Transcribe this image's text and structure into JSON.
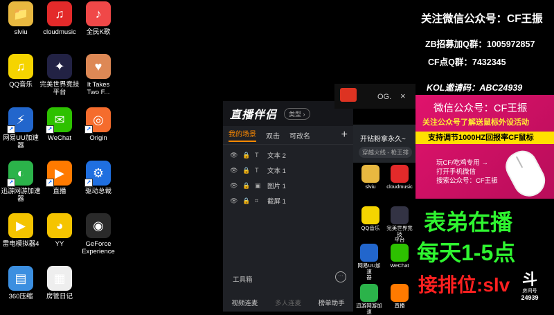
{
  "desktop_icons": [
    {
      "label": "slviu",
      "color": "#e8b840",
      "glyph": "📁"
    },
    {
      "label": "cloudmusic",
      "color": "#e32a2a",
      "glyph": "♫"
    },
    {
      "label": "全民K歌",
      "color": "#f04848",
      "glyph": "♪"
    },
    {
      "label": "QQ音乐",
      "color": "#f5d400",
      "glyph": "♫"
    },
    {
      "label": "完美世界竞技\n平台",
      "color": "#224",
      "glyph": "✦"
    },
    {
      "label": "It Takes\nTwo F...",
      "color": "#d85",
      "glyph": "♥"
    },
    {
      "label": "网易UU加速\n器",
      "color": "#2266cc",
      "glyph": "⚡"
    },
    {
      "label": "WeChat",
      "color": "#2dc100",
      "glyph": "✉"
    },
    {
      "label": "Origin",
      "color": "#f56c2d",
      "glyph": "◎"
    },
    {
      "label": "迅游网游加速\n器",
      "color": "#2bb34a",
      "glyph": "◐"
    },
    {
      "label": "直播",
      "color": "#ff7a00",
      "glyph": "▶"
    },
    {
      "label": "驱动总裁",
      "color": "#1f6fe0",
      "glyph": "⚙"
    },
    {
      "label": "雷电模拟器4",
      "color": "#f4c400",
      "glyph": "▶"
    },
    {
      "label": "YY",
      "color": "#f5c400",
      "glyph": "◕"
    },
    {
      "label": "GeForce\nExperience",
      "color": "#2a2a2a",
      "glyph": "◉"
    },
    {
      "label": "360压缩",
      "color": "#3c8fe0",
      "glyph": "▤"
    },
    {
      "label": "房管日记",
      "color": "#eeeeee",
      "glyph": "▦"
    }
  ],
  "app": {
    "logo": "直播伴侣",
    "type_label": "类型",
    "tabs": [
      "我的场景",
      "双击",
      "可改名"
    ],
    "add": "+",
    "sources": [
      {
        "icon": "T",
        "label": "文本 2"
      },
      {
        "icon": "T",
        "label": "文本 1"
      },
      {
        "icon": "▣",
        "label": "图片 1"
      },
      {
        "icon": "⌗",
        "label": "截屏 1"
      }
    ],
    "toolbox_title": "工具箱",
    "tools": [
      "视频连麦",
      "多人连麦",
      "榜单助手"
    ]
  },
  "window2": {
    "og": "OG.",
    "close": "×",
    "line1": "开钻粉拿永久~",
    "line2": "穿越火线 - 枪王排"
  },
  "mini_icons": [
    {
      "label": "slviu",
      "color": "#e8b840"
    },
    {
      "label": "cloudmusic",
      "color": "#e32a2a"
    },
    {
      "label": "QQ音乐",
      "color": "#f5d400"
    },
    {
      "label": "完美世界竞技\n平台",
      "color": "#334"
    },
    {
      "label": "网易UU加速\n器",
      "color": "#2266cc"
    },
    {
      "label": "WeChat",
      "color": "#2dc100"
    },
    {
      "label": "迅游网游加速",
      "color": "#2bb34a"
    },
    {
      "label": "直播",
      "color": "#ff7a00"
    }
  ],
  "right_panel": {
    "line1": "关注微信公众号：CF王振",
    "line2": "ZB招募加Q群：1005972857",
    "line3": "CF点Q群：7432345",
    "line4": "KOL邀请码：ABC24939",
    "ad_title": "微信公众号：CF王振",
    "ad_sub": "关注公众号了解送鼠标外设活动",
    "ad_banner": "支持调节1000HZ回报率CF鼠标",
    "ad_body": "玩CF/吃鸡专用 →\n打开手机微信\n搜索公众号：CF王振",
    "big1": "表弟在播",
    "big2": "每天1-5点",
    "big3": "接排位:slv",
    "room_label": "房间号",
    "room_num": "24939"
  }
}
